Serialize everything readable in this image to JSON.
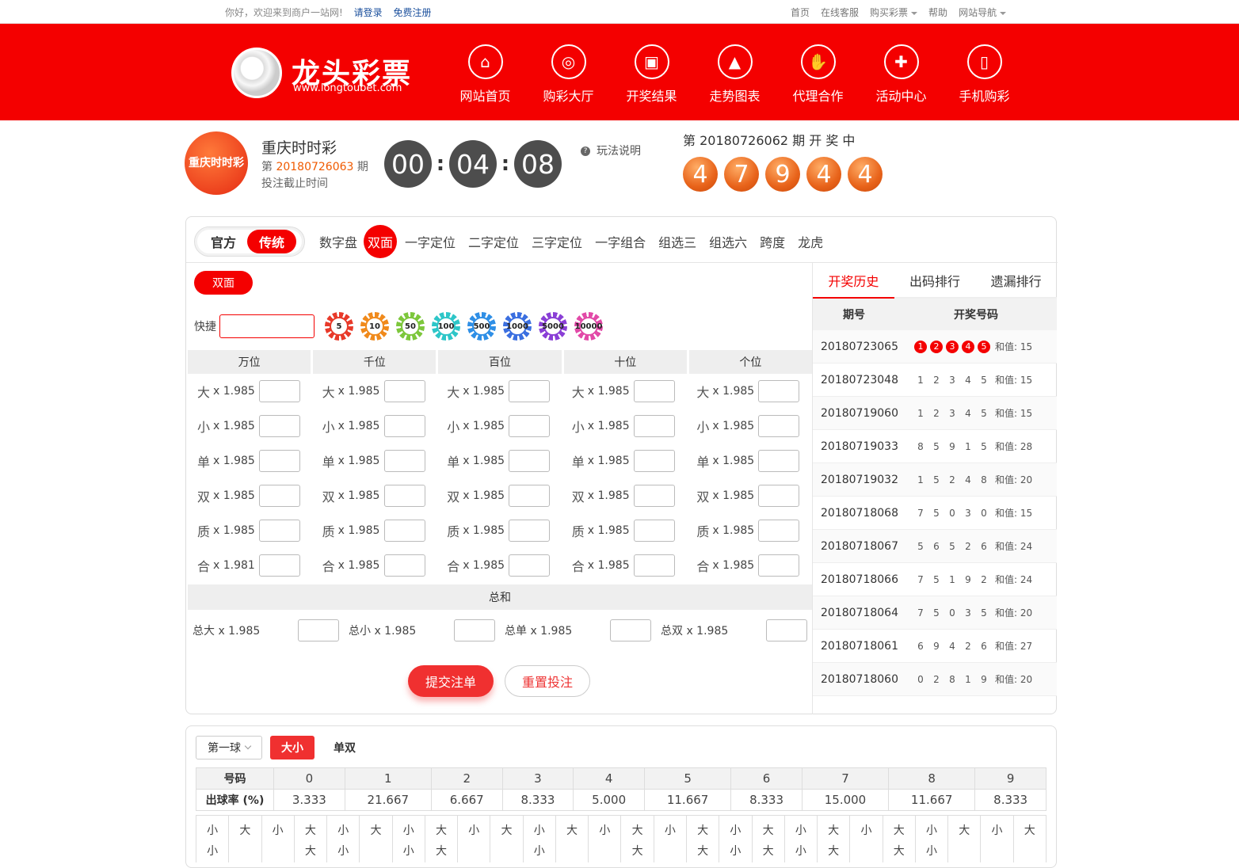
{
  "topbar": {
    "welcome": "你好，欢迎来到商户一站网!",
    "login": "请登录",
    "register": "免费注册",
    "links": [
      "首页",
      "在线客服",
      "购买彩票",
      "帮助",
      "网站导航"
    ]
  },
  "header": {
    "brand": "龙头彩票",
    "url": "www.longtoubet.com",
    "nav": [
      "网站首页",
      "购彩大厅",
      "开奖结果",
      "走势图表",
      "代理合作",
      "活动中心",
      "手机购彩"
    ]
  },
  "lottery": {
    "logo_text": "重庆时时彩",
    "name": "重庆时时彩",
    "issue_prefix": "第",
    "issue": "20180726063",
    "issue_suffix": "期",
    "deadline_label": "投注截止时间",
    "timer": [
      "00",
      "04",
      "08"
    ],
    "help": "玩法说明",
    "draw_title": "第 20180726062 期 开 奖 中",
    "draw_balls": [
      "4",
      "7",
      "9",
      "4",
      "4"
    ]
  },
  "mode": {
    "official": "官方",
    "traditional": "传统"
  },
  "play_tabs": [
    "数字盘",
    "双面",
    "一字定位",
    "二字定位",
    "三字定位",
    "一字组合",
    "组选三",
    "组选六",
    "跨度",
    "龙虎"
  ],
  "active_play": "双面",
  "sub_button": "双面",
  "quick_label": "快捷",
  "chips": [
    {
      "value": "5",
      "color": "#e83a2a"
    },
    {
      "value": "10",
      "color": "#f08a1c"
    },
    {
      "value": "50",
      "color": "#7dc73c"
    },
    {
      "value": "100",
      "color": "#2ec6c8"
    },
    {
      "value": "500",
      "color": "#2f8fe6"
    },
    {
      "value": "1000",
      "color": "#3b6fe0"
    },
    {
      "value": "5000",
      "color": "#8a3fd6"
    },
    {
      "value": "10000",
      "color": "#e24aa8"
    }
  ],
  "positions": [
    "万位",
    "千位",
    "百位",
    "十位",
    "个位"
  ],
  "bet_rows": [
    {
      "name": "大",
      "odds": [
        "x 1.985",
        "x 1.985",
        "x 1.985",
        "x 1.985",
        "x 1.985"
      ]
    },
    {
      "name": "小",
      "odds": [
        "x 1.985",
        "x 1.985",
        "x 1.985",
        "x 1.985",
        "x 1.985"
      ]
    },
    {
      "name": "单",
      "odds": [
        "x 1.985",
        "x 1.985",
        "x 1.985",
        "x 1.985",
        "x 1.985"
      ]
    },
    {
      "name": "双",
      "odds": [
        "x 1.985",
        "x 1.985",
        "x 1.985",
        "x 1.985",
        "x 1.985"
      ]
    },
    {
      "name": "质",
      "odds": [
        "x 1.985",
        "x 1.985",
        "x 1.985",
        "x 1.985",
        "x 1.985"
      ]
    },
    {
      "name": "合",
      "odds": [
        "x 1.981",
        "x 1.985",
        "x 1.985",
        "x 1.985",
        "x 1.985"
      ]
    }
  ],
  "sum_title": "总和",
  "sum_items": [
    "总大 x 1.985",
    "总小 x 1.985",
    "总单 x 1.985",
    "总双 x 1.985"
  ],
  "submit": "提交注单",
  "reset": "重置投注",
  "history": {
    "tabs": [
      "开奖历史",
      "出码排行",
      "遗漏排行"
    ],
    "col_issue": "期号",
    "col_nums": "开奖号码",
    "sum_label": "和值:",
    "rows": [
      {
        "issue": "20180723065",
        "nums": [
          "1",
          "2",
          "3",
          "4",
          "5"
        ],
        "sum": "15",
        "red": true
      },
      {
        "issue": "20180723048",
        "nums": [
          "1",
          "2",
          "3",
          "4",
          "5"
        ],
        "sum": "15"
      },
      {
        "issue": "20180719060",
        "nums": [
          "1",
          "2",
          "3",
          "4",
          "5"
        ],
        "sum": "15"
      },
      {
        "issue": "20180719033",
        "nums": [
          "8",
          "5",
          "9",
          "1",
          "5"
        ],
        "sum": "28"
      },
      {
        "issue": "20180719032",
        "nums": [
          "1",
          "5",
          "2",
          "4",
          "8"
        ],
        "sum": "20"
      },
      {
        "issue": "20180718068",
        "nums": [
          "7",
          "5",
          "0",
          "3",
          "0"
        ],
        "sum": "15"
      },
      {
        "issue": "20180718067",
        "nums": [
          "5",
          "6",
          "5",
          "2",
          "6"
        ],
        "sum": "24"
      },
      {
        "issue": "20180718066",
        "nums": [
          "7",
          "5",
          "1",
          "9",
          "2"
        ],
        "sum": "24"
      },
      {
        "issue": "20180718064",
        "nums": [
          "7",
          "5",
          "0",
          "3",
          "5"
        ],
        "sum": "20"
      },
      {
        "issue": "20180718061",
        "nums": [
          "6",
          "9",
          "4",
          "2",
          "6"
        ],
        "sum": "27"
      },
      {
        "issue": "20180718060",
        "nums": [
          "0",
          "2",
          "8",
          "1",
          "9"
        ],
        "sum": "20"
      }
    ]
  },
  "stats": {
    "select": "第一球",
    "toggle_on": "大小",
    "toggle_off": "单双",
    "label_num": "号码",
    "label_rate": "出球率 (%)",
    "numbers": [
      "0",
      "1",
      "2",
      "3",
      "4",
      "5",
      "6",
      "7",
      "8",
      "9"
    ],
    "rates": [
      "3.333",
      "21.667",
      "6.667",
      "8.333",
      "5.000",
      "11.667",
      "8.333",
      "15.000",
      "11.667",
      "8.333"
    ],
    "trend": [
      [
        "小",
        "小"
      ],
      [
        "大"
      ],
      [
        "小"
      ],
      [
        "大",
        "大"
      ],
      [
        "小",
        "小"
      ],
      [
        "大"
      ],
      [
        "小",
        "小"
      ],
      [
        "大",
        "大"
      ],
      [
        "小"
      ],
      [
        "大"
      ],
      [
        "小",
        "小"
      ],
      [
        "大"
      ],
      [
        "小"
      ],
      [
        "大",
        "大"
      ],
      [
        "小"
      ],
      [
        "大",
        "大"
      ],
      [
        "小",
        "小"
      ],
      [
        "大",
        "大"
      ],
      [
        "小",
        "小"
      ],
      [
        "大",
        "大"
      ],
      [
        "小"
      ],
      [
        "大",
        "大"
      ],
      [
        "小",
        "小"
      ],
      [
        "大"
      ],
      [
        "小"
      ],
      [
        "大"
      ]
    ]
  }
}
